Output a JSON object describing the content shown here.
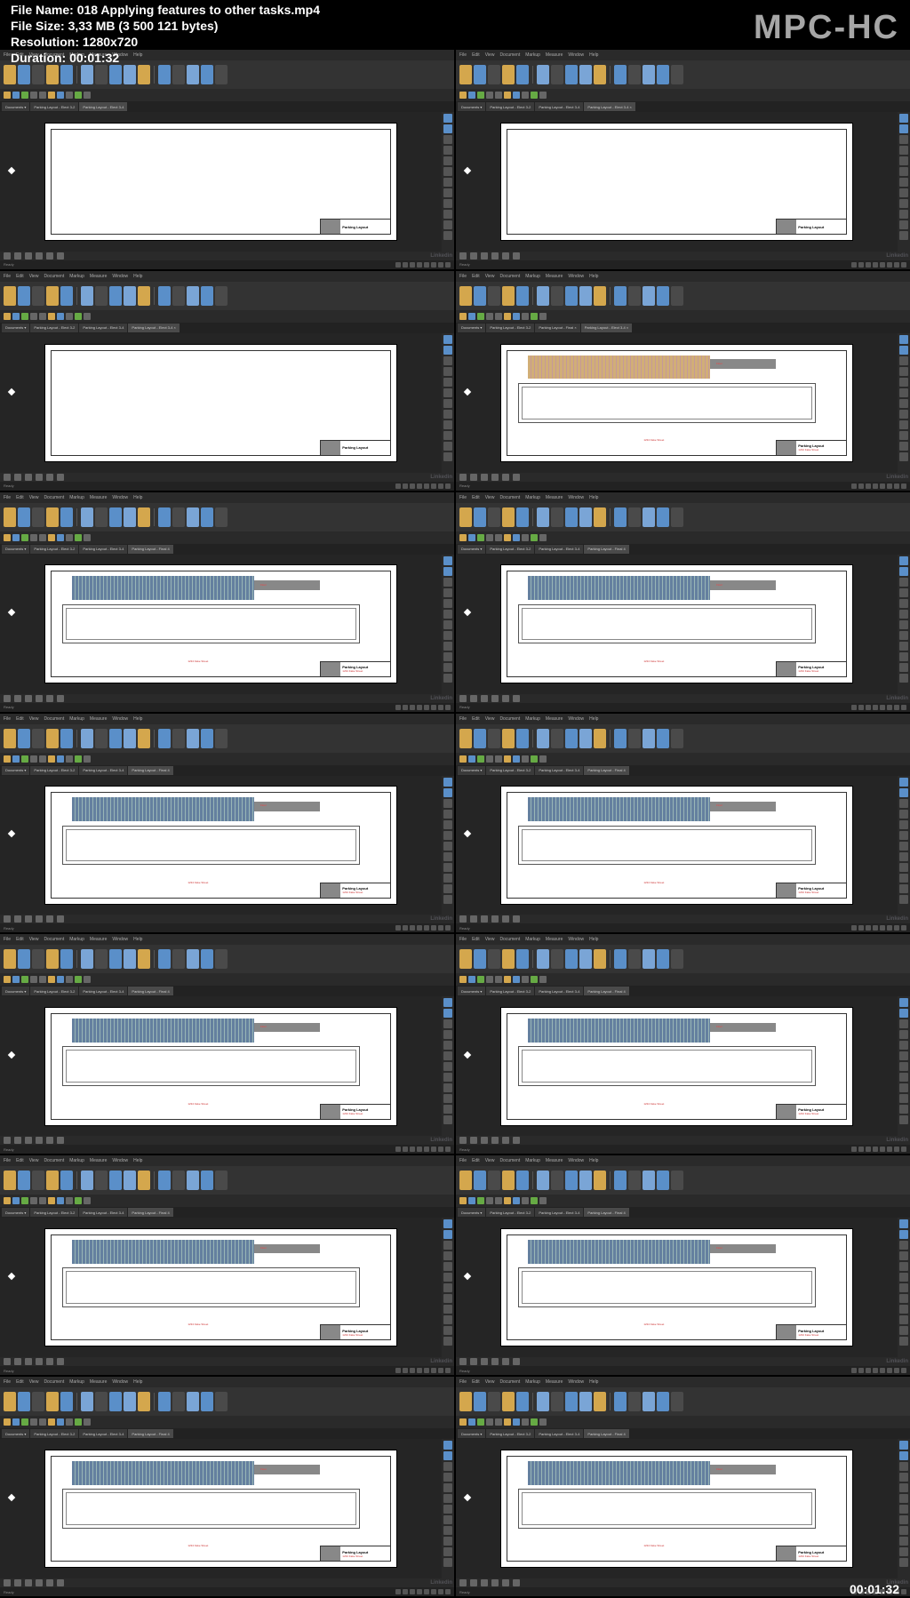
{
  "player": "MPC-HC",
  "file_info": {
    "name_label": "File Name: 018 Applying features to other tasks.mp4",
    "size_label": "File Size: 3,33 MB (3 500 121 bytes)",
    "resolution_label": "Resolution: 1280x720",
    "duration_label": "Duration: 00:01:32"
  },
  "timestamp": "00:01:32",
  "app": {
    "menus": [
      "File",
      "Edit",
      "View",
      "Document",
      "Markup",
      "Measure",
      "Window",
      "Help"
    ],
    "tabs": {
      "documents": "Documents ▾",
      "layout1": "Parking Layout - Elect 3-2",
      "layout2": "Parking Layout - Elect 3-4",
      "layout3": "Parking Layout - Elect 3-4 ×",
      "layout_final": "Parking Layout - Final ×",
      "layout_final2": "Parking Layout - Final 4"
    },
    "title_block": {
      "title": "Parking Layout",
      "address": "1234 Fake Street"
    },
    "floor_label": "Floor",
    "status": "Ready",
    "watermark": "Linkedin"
  },
  "thumbs": [
    {
      "type": "blank",
      "tabs": [
        "documents",
        "layout1",
        "layout2"
      ]
    },
    {
      "type": "blank",
      "tabs": [
        "documents",
        "layout1",
        "layout2",
        "layout3"
      ]
    },
    {
      "type": "blank",
      "tabs": [
        "documents",
        "layout1",
        "layout2",
        "layout3"
      ]
    },
    {
      "type": "plan",
      "orange": true,
      "tabs": [
        "documents",
        "layout1",
        "layout_final",
        "layout3"
      ]
    },
    {
      "type": "plan",
      "tabs": [
        "documents",
        "layout1",
        "layout2",
        "layout_final2"
      ]
    },
    {
      "type": "plan",
      "tabs": [
        "documents",
        "layout1",
        "layout2",
        "layout_final2"
      ]
    },
    {
      "type": "plan",
      "tabs": [
        "documents",
        "layout1",
        "layout2",
        "layout_final2"
      ]
    },
    {
      "type": "plan",
      "tabs": [
        "documents",
        "layout1",
        "layout2",
        "layout_final2"
      ]
    },
    {
      "type": "plan",
      "tabs": [
        "documents",
        "layout1",
        "layout2",
        "layout_final2"
      ]
    },
    {
      "type": "plan",
      "tabs": [
        "documents",
        "layout1",
        "layout2",
        "layout_final2"
      ]
    },
    {
      "type": "plan",
      "tabs": [
        "documents",
        "layout1",
        "layout2",
        "layout_final2"
      ]
    },
    {
      "type": "plan",
      "tabs": [
        "documents",
        "layout1",
        "layout2",
        "layout_final2"
      ]
    },
    {
      "type": "plan",
      "tabs": [
        "documents",
        "layout1",
        "layout2",
        "layout_final2"
      ]
    },
    {
      "type": "plan",
      "tabs": [
        "documents",
        "layout1",
        "layout2",
        "layout_final2"
      ]
    }
  ]
}
